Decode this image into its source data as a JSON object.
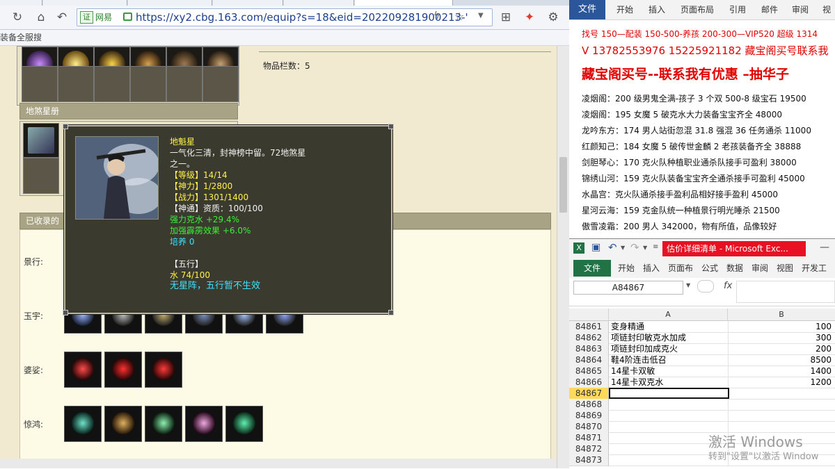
{
  "browser": {
    "cert_label": "证",
    "cert_name": "网易",
    "url": "https://xy2.cbg.163.com/equip?s=18&eid=202209281900213-'",
    "bookmarks_text": "装备全服搜",
    "item_count_label": "物品栏数：5",
    "star_panel_title": "地煞星册",
    "collected_panel_title": "已收录的",
    "rows": [
      {
        "label": "景行:"
      },
      {
        "label": "玉宇:"
      },
      {
        "label": "婆娑:"
      },
      {
        "label": "惊鸿:"
      }
    ]
  },
  "tooltip": {
    "name": "地魁星",
    "desc1": "一气化三清，封神榜中留。72地煞星",
    "desc2": "之一。",
    "level": "【等级】14/14",
    "shenli": "【神力】1/2800",
    "zhanli": "【战力】1301/1400",
    "shentong": "【神通】资质：100/100",
    "attr1": "强力克水 +29.4%",
    "attr2": "加强霹雳效果 +6.0%",
    "attr3": "培养 0",
    "wuxing_title": "【五行】",
    "wuxing_value": "水 74/100",
    "wuxing_note": "无星阵，五行暂不生效"
  },
  "word": {
    "file_tab": "文件",
    "tabs": [
      "开始",
      "插入",
      "页面布局",
      "引用",
      "邮件",
      "审阅",
      "视"
    ],
    "line1": "找号 150—配装 150-500-养孩 200-300—VIP520 超级 1314",
    "line2": "V 13782553976    15225921182   藏宝阁买号联系我",
    "headline": "藏宝阁买号--联系我有优惠 –抽华子",
    "listings": [
      "凌烟阁：200 级男鬼全满-孩子 3 个双 500-8 级宝石 19500",
      "凌烟阁：195 女魔 5 破克水大力装备宝宝齐全 48000",
      "龙吟东方：174 男人站街忽混 31.8 强混 36 任务通杀 11000",
      "红颜知己：184 女魔 5 破传世金麟 2 老孩装备齐全 38888",
      "剑胆琴心：170 克火队种植职业通杀队接手可盈利 38000",
      "锦绣山河：159 克火队装备宝宝齐全通杀接手可盈利 45000",
      "水晶宫：克火队通杀接手盈利品相好接手盈利 45000",
      "星河云海：159 克金队统一种植景行明光睡杀 21500",
      "傲雪凌霜：200 男人 342000，物有所值，品像较好"
    ]
  },
  "excel": {
    "title": "估价详细清单 - Microsoft Exc...",
    "file_tab": "文件",
    "tabs": [
      "开始",
      "插入",
      "页面布",
      "公式",
      "数据",
      "审阅",
      "视图",
      "开发工"
    ],
    "name_box": "A84867",
    "fx_label": "fx",
    "col_a": "A",
    "col_b": "B",
    "rows": [
      {
        "n": "84861",
        "a": "变身精通",
        "b": "100"
      },
      {
        "n": "84862",
        "a": "项链封印敏克水加成",
        "b": "300"
      },
      {
        "n": "84863",
        "a": "项链封印加成克火",
        "b": "200"
      },
      {
        "n": "84864",
        "a": "鞋4阶连击低召",
        "b": "8500"
      },
      {
        "n": "84865",
        "a": "14星卡双敏",
        "b": "1400"
      },
      {
        "n": "84866",
        "a": "14星卡双克水",
        "b": "1200"
      },
      {
        "n": "84867",
        "a": "",
        "b": ""
      },
      {
        "n": "84868",
        "a": "",
        "b": ""
      },
      {
        "n": "84869",
        "a": "",
        "b": ""
      },
      {
        "n": "84870",
        "a": "",
        "b": ""
      },
      {
        "n": "84871",
        "a": "",
        "b": ""
      },
      {
        "n": "84872",
        "a": "",
        "b": ""
      },
      {
        "n": "84873",
        "a": "",
        "b": ""
      }
    ],
    "watermark": "激活 Windows",
    "watermark_sub": "转到\"设置\"以激活 Window"
  },
  "colors": {
    "word_file_blue": "#2b579a",
    "excel_green": "#217346",
    "headline_red": "#e60000",
    "tooltip_yellow": "#fff24a",
    "tooltip_green": "#3cf03c",
    "tooltip_cyan": "#3fe3ff"
  }
}
